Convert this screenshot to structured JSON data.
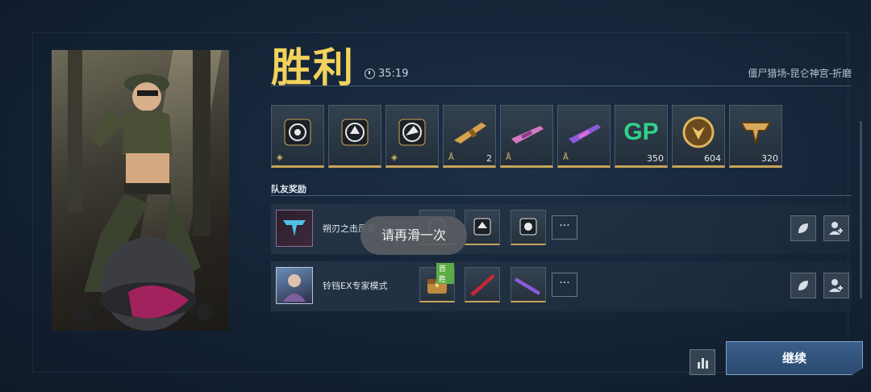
{
  "result": {
    "title": "胜利",
    "time": "35:19",
    "map": "僵尸猎场-昆仑神宫-折磨"
  },
  "rewards": [
    {
      "icon": "skull-target-emblem-icon",
      "count": ""
    },
    {
      "icon": "radiant-emblem-icon",
      "count": ""
    },
    {
      "icon": "rider-emblem-icon",
      "count": ""
    },
    {
      "icon": "golden-rifle-icon",
      "count": "2"
    },
    {
      "icon": "pink-rifle-icon",
      "count": ""
    },
    {
      "icon": "purple-rifle-icon",
      "count": ""
    },
    {
      "icon": "gp-currency-icon",
      "count": "350",
      "label": "GP"
    },
    {
      "icon": "gold-coin-icon",
      "count": "604"
    },
    {
      "icon": "tf-badge-icon",
      "count": "320"
    }
  ],
  "teammates": {
    "section_title": "队友奖励",
    "rows": [
      {
        "name": "朔刃之击凤是",
        "items": [
          "faded-emblem-icon",
          "box-emblem-icon",
          "crest-emblem-icon"
        ],
        "more": "···"
      },
      {
        "name": "铃铛EX专家模式",
        "items": [
          "treasure-chest-icon",
          "red-blade-icon",
          "purple-blade-icon"
        ],
        "tag": "首胜",
        "more": "···"
      }
    ]
  },
  "toast": "请再滑一次",
  "buttons": {
    "continue": "继续"
  },
  "colors": {
    "title": "#f1d35c",
    "accent": "#c7a35a",
    "button": "#2b4a70"
  }
}
